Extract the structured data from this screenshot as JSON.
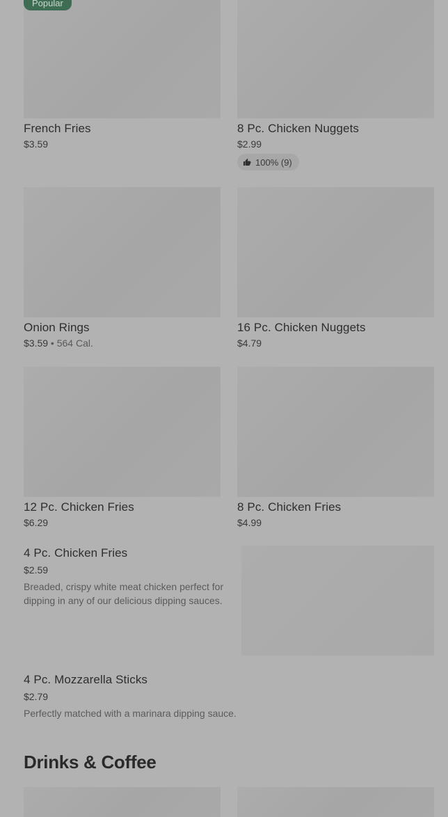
{
  "badge": {
    "popular": "Popular"
  },
  "items": [
    {
      "name": "French Fries",
      "price": "$3.59"
    },
    {
      "name": "8 Pc. Chicken Nuggets",
      "price": "$2.99",
      "rating": "100% (9)"
    },
    {
      "name": "Onion Rings",
      "price": "$3.59",
      "separator": " • ",
      "calories": "564 Cal."
    },
    {
      "name": "16 Pc. Chicken Nuggets",
      "price": "$4.79"
    },
    {
      "name": "12 Pc. Chicken Fries",
      "price": "$6.29"
    },
    {
      "name": "8 Pc. Chicken Fries",
      "price": "$4.99"
    },
    {
      "name": "4 Pc. Chicken Fries",
      "price": "$2.59",
      "description": "Breaded, crispy white meat chicken perfect for dipping in any of our delicious dipping sauces."
    },
    {
      "name": "4 Pc. Mozzarella Sticks",
      "price": "$2.79",
      "description": "Perfectly matched with a marinara dipping sauce."
    }
  ],
  "sections": {
    "drinks": "Drinks & Coffee"
  },
  "icons": {
    "rating": "thumbs-up-icon"
  }
}
